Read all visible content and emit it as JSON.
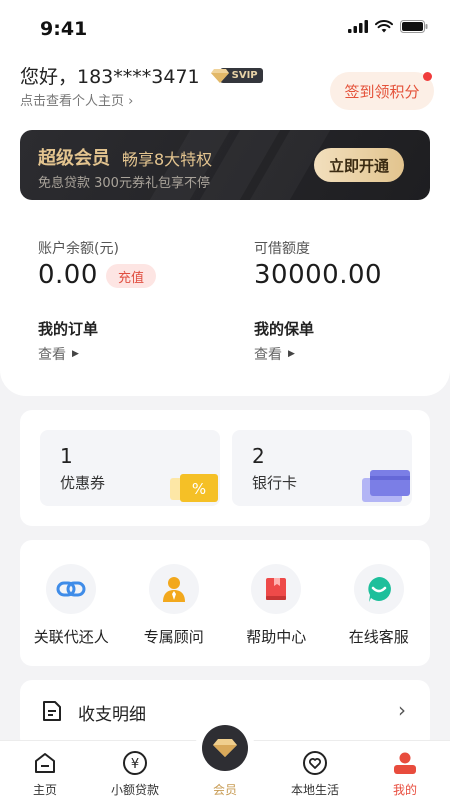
{
  "status_bar": {
    "time": "9:41"
  },
  "header": {
    "greeting": "您好，183****3471",
    "vip_badge": "SVIP",
    "profile_link": "点击查看个人主页 ›",
    "signin_button": "签到领积分"
  },
  "vip_banner": {
    "title": "超级会员",
    "subtitle": "畅享8大特权",
    "description": "免息贷款  300元券礼包享不停",
    "button": "立即开通"
  },
  "account": {
    "balance_label": "账户余额(元)",
    "balance_value": "0.00",
    "recharge_button": "充值",
    "credit_label": "可借额度",
    "credit_value": "30000.00",
    "orders_title": "我的订单",
    "orders_link": "查看",
    "policies_title": "我的保单",
    "policies_link": "查看"
  },
  "assets": {
    "coupons": {
      "count": "1",
      "label": "优惠券"
    },
    "bank_cards": {
      "count": "2",
      "label": "银行卡"
    }
  },
  "services": [
    {
      "label": "关联代还人",
      "icon": "link-icon"
    },
    {
      "label": "专属顾问",
      "icon": "advisor-icon"
    },
    {
      "label": "帮助中心",
      "icon": "book-icon"
    },
    {
      "label": "在线客服",
      "icon": "chat-icon"
    }
  ],
  "transactions_row": {
    "label": "收支明细",
    "icon": "document-icon"
  },
  "bottom_nav": [
    {
      "label": "主页",
      "icon": "home-icon"
    },
    {
      "label": "小额贷款",
      "icon": "yen-icon"
    },
    {
      "label": "会员",
      "icon": "diamond-icon"
    },
    {
      "label": "本地生活",
      "icon": "heart-pin-icon"
    },
    {
      "label": "我的",
      "icon": "user-icon"
    }
  ],
  "colors": {
    "accent_red": "#e84c3d",
    "gold": "#e3c48f",
    "dark_banner": "#2c2c30",
    "link_blue": "#3f8ce8",
    "advisor_orange": "#f2a81d",
    "help_red": "#ee4a49",
    "chat_green": "#1dbf9b"
  }
}
